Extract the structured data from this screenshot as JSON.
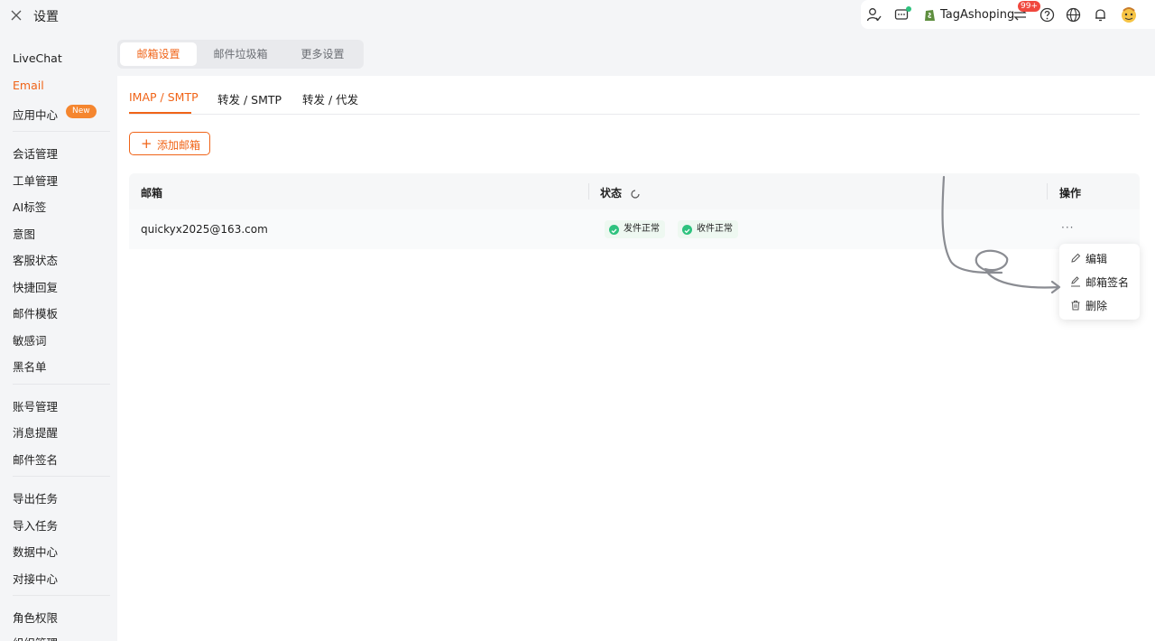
{
  "header": {
    "title": "设置",
    "shop_name": "TagAshoping",
    "notification_badge": "99+"
  },
  "sidebar": {
    "items": [
      {
        "label": "LiveChat"
      },
      {
        "label": "Email"
      },
      {
        "label": "应用中心"
      },
      {
        "label": "会话管理"
      },
      {
        "label": "工单管理"
      },
      {
        "label": "AI标签"
      },
      {
        "label": "意图"
      },
      {
        "label": "客服状态"
      },
      {
        "label": "快捷回复"
      },
      {
        "label": "邮件模板"
      },
      {
        "label": "敏感词"
      },
      {
        "label": "黑名单"
      },
      {
        "label": "账号管理"
      },
      {
        "label": "消息提醒"
      },
      {
        "label": "邮件签名"
      },
      {
        "label": "导出任务"
      },
      {
        "label": "导入任务"
      },
      {
        "label": "数据中心"
      },
      {
        "label": "对接中心"
      },
      {
        "label": "角色权限"
      },
      {
        "label": "组织管理"
      }
    ],
    "new_badge": "New"
  },
  "segments": [
    "邮箱设置",
    "邮件垃圾箱",
    "更多设置"
  ],
  "tabs": [
    "IMAP / SMTP",
    "转发 / SMTP",
    "转发 / 代发"
  ],
  "add_button": "添加邮箱",
  "table": {
    "headers": {
      "mailbox": "邮箱",
      "status": "状态",
      "actions": "操作"
    },
    "rows": [
      {
        "email": "quickyx2025@163.com",
        "send_status": "发件正常",
        "receive_status": "收件正常",
        "more": "···"
      }
    ]
  },
  "menu": {
    "items": [
      "编辑",
      "邮箱签名",
      "删除"
    ]
  },
  "colors": {
    "accent": "#f06418",
    "success": "#2ec27e",
    "badge": "#f0483e"
  }
}
